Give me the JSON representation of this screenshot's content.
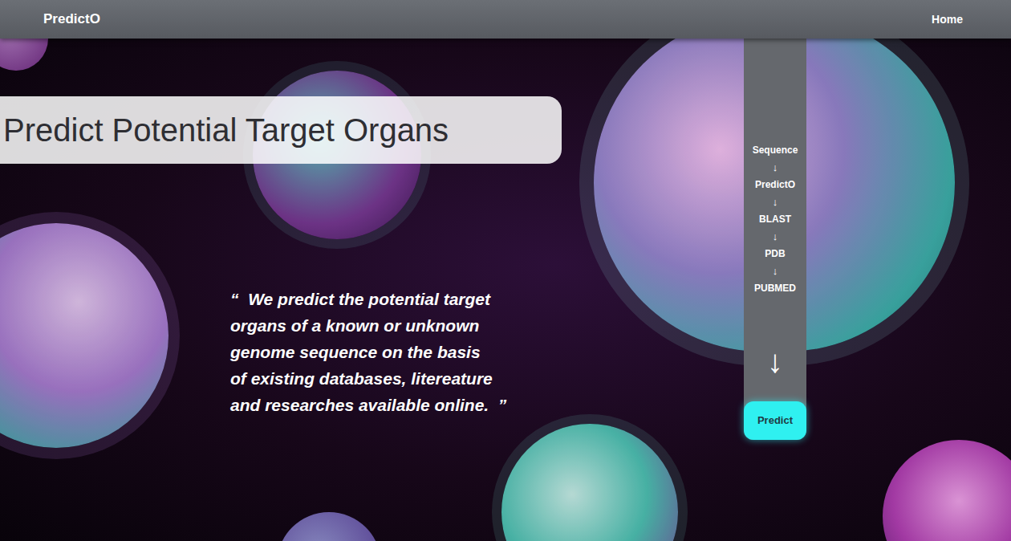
{
  "nav": {
    "brand": "PredictO",
    "links": [
      {
        "label": "Home",
        "selected": false
      }
    ]
  },
  "hero": {
    "title": "Predict Potential Target Organs",
    "quote_lines": [
      "“  We predict the potential target",
      "organs of a known or unknown",
      "genome sequence on the basis",
      "of existing databases, litereature",
      "and researches available online.  ”"
    ]
  },
  "pipeline": {
    "items": [
      {
        "text": "Sequence",
        "kind": "step",
        "highlighted": false
      },
      {
        "text": "↓",
        "kind": "arrow",
        "highlighted": false
      },
      {
        "text": "PredictO",
        "kind": "step",
        "highlighted": true
      },
      {
        "text": "↓",
        "kind": "arrow",
        "highlighted": false
      },
      {
        "text": "BLAST",
        "kind": "step",
        "highlighted": false
      },
      {
        "text": "↓",
        "kind": "arrow",
        "highlighted": false
      },
      {
        "text": "PDB",
        "kind": "step",
        "highlighted": false
      },
      {
        "text": "↓",
        "kind": "arrow",
        "highlighted": false
      },
      {
        "text": "PUBMED",
        "kind": "step",
        "highlighted": false
      }
    ],
    "big_arrow": "↓",
    "button": "Predict"
  }
}
